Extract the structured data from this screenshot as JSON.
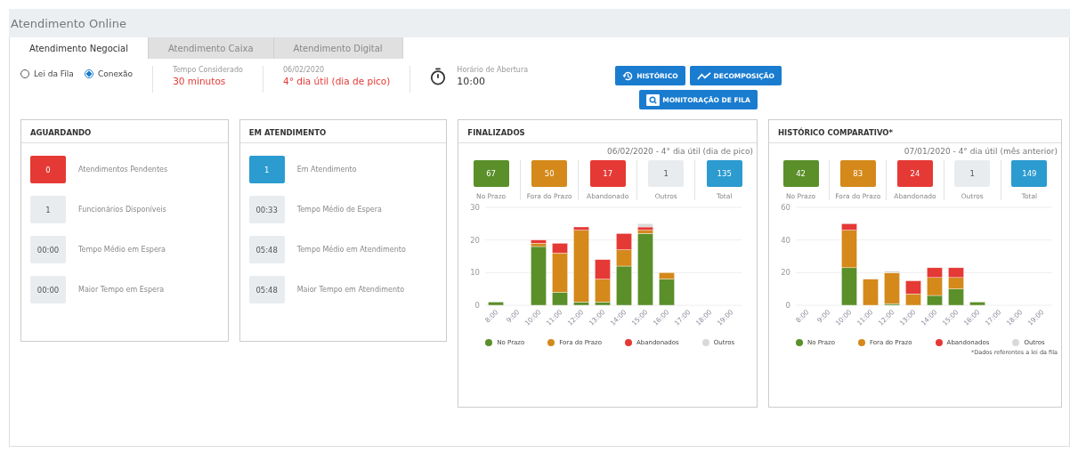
{
  "page": {
    "title": "Atendimento Online"
  },
  "tabs": [
    {
      "label": "Atendimento Negocial",
      "selected": true
    },
    {
      "label": "Atendimento Caixa",
      "selected": false
    },
    {
      "label": "Atendimento Digital",
      "selected": false
    }
  ],
  "criteria": [
    {
      "label": "Lei da Fila",
      "selected": false
    },
    {
      "label": "Conexão",
      "selected": true
    }
  ],
  "info": [
    {
      "label": "Tempo Considerado",
      "value": "30 minutos"
    },
    {
      "label": "06/02/2020",
      "value": "4° dia útil (dia de pico)"
    }
  ],
  "opening": {
    "label": "Horário de Abertura",
    "value": "10:00"
  },
  "buttons": [
    {
      "label": "HISTÓRICO",
      "kind": "history"
    },
    {
      "label": "DECOMPOSIÇÃO",
      "kind": "trend"
    },
    {
      "label": "MONITORAÇÃO DE FILA",
      "kind": "monitor"
    }
  ],
  "cards": [
    {
      "title": "AGUARDANDO",
      "rows": [
        {
          "value": "0",
          "label": "Atendimentos Pendentes",
          "color": "#e53935"
        },
        {
          "value": "1",
          "label": "Funcionários Disponíveis",
          "color": "#e9ecef"
        },
        {
          "value": "00:00",
          "label": "Tempo Médio em Espera",
          "color": "#e9ecef"
        },
        {
          "value": "00:00",
          "label": "Maior Tempo em Espera",
          "color": "#e9ecef"
        }
      ]
    },
    {
      "title": "EM ATENDIMENTO",
      "rows": [
        {
          "value": "1",
          "label": "Em Atendimento",
          "color": "#2b9bd0"
        },
        {
          "value": "00:33",
          "label": "Tempo Médio de Espera",
          "color": "#e9ecef"
        },
        {
          "value": "05:48",
          "label": "Tempo Médio em Atendimento",
          "color": "#e9ecef"
        },
        {
          "value": "05:48",
          "label": "Maior Tempo em Atendimento",
          "color": "#e9ecef"
        }
      ]
    }
  ],
  "panels": [
    {
      "title": "FINALIZADOS",
      "subtitle": "06/02/2020 - 4° dia útil (dia de pico)",
      "stats": [
        {
          "value": "67",
          "label": "No Prazo",
          "color": "#5a8f29"
        },
        {
          "value": "50",
          "label": "Fora do Prazo",
          "color": "#d4891a"
        },
        {
          "value": "17",
          "label": "Abandonado",
          "color": "#e53935"
        },
        {
          "value": "1",
          "label": "Outros",
          "color": "#e9ecef"
        },
        {
          "value": "135",
          "label": "Total",
          "color": "#2b9bd0"
        }
      ],
      "chart_data": {
        "type": "bar",
        "stacked": true,
        "categories": [
          "8:00",
          "9:00",
          "10:00",
          "11:00",
          "12:00",
          "13:00",
          "14:00",
          "15:00",
          "16:00",
          "17:00",
          "18:00",
          "19:00"
        ],
        "ylim": [
          0,
          30
        ],
        "yticks": [
          0,
          10,
          20,
          30
        ],
        "series": [
          {
            "name": "No Prazo",
            "color": "#5a8f29",
            "values": [
              1,
              0,
              18,
              4,
              1,
              1,
              12,
              22,
              8,
              0,
              0,
              0
            ]
          },
          {
            "name": "Fora do Prazo",
            "color": "#d4891a",
            "values": [
              0,
              0,
              1,
              12,
              22,
              7,
              5,
              1,
              2,
              0,
              0,
              0
            ]
          },
          {
            "name": "Abandonados",
            "color": "#e53935",
            "values": [
              0,
              0,
              1,
              3,
              1,
              6,
              5,
              1,
              0,
              0,
              0,
              0
            ]
          },
          {
            "name": "Outros",
            "color": "#d9d9d9",
            "values": [
              0,
              0,
              0,
              0,
              0,
              0,
              0,
              1,
              0,
              0,
              0,
              0
            ]
          }
        ]
      }
    },
    {
      "title": "HISTÓRICO COMPARATIVO*",
      "subtitle": "07/01/2020 - 4° dia útil (mês anterior)",
      "stats": [
        {
          "value": "42",
          "label": "No Prazo",
          "color": "#5a8f29"
        },
        {
          "value": "83",
          "label": "Fora do Prazo",
          "color": "#d4891a"
        },
        {
          "value": "24",
          "label": "Abandonado",
          "color": "#e53935"
        },
        {
          "value": "1",
          "label": "Outros",
          "color": "#e9ecef"
        },
        {
          "value": "149",
          "label": "Total",
          "color": "#2b9bd0"
        }
      ],
      "chart_data": {
        "type": "bar",
        "stacked": true,
        "categories": [
          "8:00",
          "9:00",
          "10:00",
          "11:00",
          "12:00",
          "13:00",
          "14:00",
          "15:00",
          "16:00",
          "17:00",
          "18:00",
          "19:00"
        ],
        "ylim": [
          0,
          60
        ],
        "yticks": [
          0,
          20,
          40,
          60
        ],
        "series": [
          {
            "name": "No Prazo",
            "color": "#5a8f29",
            "values": [
              0,
              0,
              23,
              0,
              1,
              0,
              6,
              10,
              2,
              0,
              0,
              0
            ]
          },
          {
            "name": "Fora do Prazo",
            "color": "#d4891a",
            "values": [
              0,
              0,
              23,
              16,
              19,
              7,
              11,
              7,
              0,
              0,
              0,
              0
            ]
          },
          {
            "name": "Abandonados",
            "color": "#e53935",
            "values": [
              0,
              0,
              4,
              0,
              0,
              8,
              6,
              6,
              0,
              0,
              0,
              0
            ]
          },
          {
            "name": "Outros",
            "color": "#d9d9d9",
            "values": [
              0,
              0,
              0,
              0,
              1,
              0,
              0,
              0,
              0,
              0,
              0,
              0
            ]
          }
        ]
      },
      "footnote": "*Dados referentes a lei da fila"
    }
  ]
}
